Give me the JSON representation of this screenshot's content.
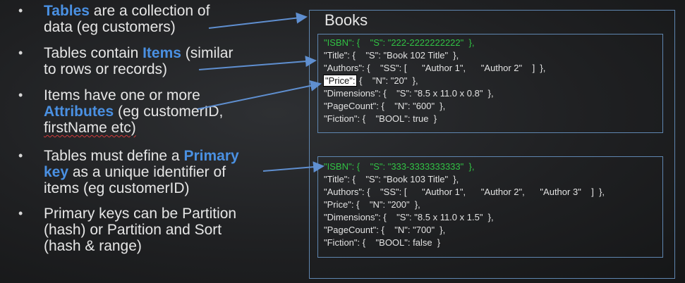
{
  "bullets": [
    {
      "lines": [
        [
          {
            "t": "Tables",
            "hl": true
          },
          {
            "t": " are a collection of"
          }
        ],
        [
          {
            "t": "data (eg customers)"
          }
        ]
      ]
    },
    {
      "lines": [
        [
          {
            "t": "Tables contain "
          },
          {
            "t": "Items",
            "hl": true
          },
          {
            "t": " (similar"
          }
        ],
        [
          {
            "t": "to rows or records)"
          }
        ]
      ]
    },
    {
      "lines": [
        [
          {
            "t": "Items have one or more"
          }
        ],
        [
          {
            "t": "Attributes",
            "hl": true
          },
          {
            "t": " (eg customerID,"
          }
        ],
        [
          {
            "t": "firstName etc)"
          }
        ]
      ]
    },
    {
      "lines": [
        [
          {
            "t": "Tables must define a "
          },
          {
            "t": "Primary",
            "hl": true
          }
        ],
        [
          {
            "t": "key",
            "hl": true
          },
          {
            "t": " as a unique identifier of"
          }
        ],
        [
          {
            "t": "items (eg customerID)"
          }
        ]
      ]
    },
    {
      "lines": [
        [
          {
            "t": "Primary keys can be Partition"
          }
        ],
        [
          {
            "t": "(hash) or Partition and Sort"
          }
        ],
        [
          {
            "t": "(hash & range)"
          }
        ]
      ]
    }
  ],
  "bullet_char": "•",
  "books": {
    "title": "Books",
    "item1": {
      "isbn": "\"ISBN\": {    \"S\": \"222-2222222222\"  },",
      "title": "\"Title\": {    \"S\": \"Book 102 Title\"  },",
      "authors": "\"Authors\": {    \"SS\": [      \"Author 1\",      \"Author 2\"    ]  },",
      "price_key": "\"Price\":",
      "price_rest": " {    \"N\": \"20\"  },",
      "dimensions": "\"Dimensions\": {    \"S\": \"8.5 x 11.0 x 0.8\"  },",
      "pagecount": "\"PageCount\": {    \"N\": \"600\"  },",
      "fiction": "\"Fiction\": {    \"BOOL\": true  }"
    },
    "item2": {
      "isbn": "\"ISBN\": {    \"S\": \"333-3333333333\"  },",
      "title": "\"Title\": {    \"S\": \"Book 103 Title\"  },",
      "authors": "\"Authors\": {    \"SS\": [      \"Author 1\",      \"Author 2\",      \"Author 3\"    ]  },",
      "price": "\"Price\": {    \"N\": \"200\"  },",
      "dimensions": "\"Dimensions\": {    \"S\": \"8.5 x 11.0 x 1.5\"  },",
      "pagecount": "\"PageCount\": {    \"N\": \"700\"  },",
      "fiction": "\"Fiction\": {    \"BOOL\": false  }"
    }
  },
  "colors": {
    "accent": "#4a90e2",
    "key_green": "#31c244",
    "frame": "#5f86b0",
    "background": "#1f2022"
  }
}
